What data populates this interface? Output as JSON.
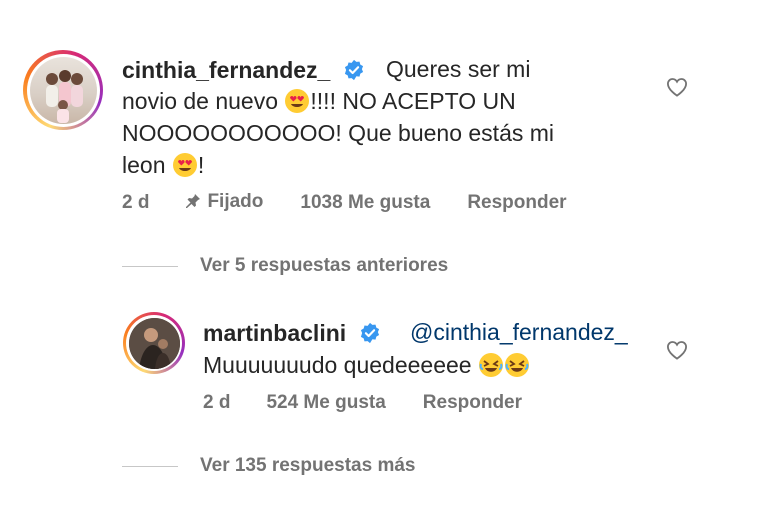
{
  "comments": [
    {
      "username": "cinthia_fernandez_",
      "verified": true,
      "text_line1": "Queres ser mi",
      "text_line2_a": "novio de nuevo",
      "text_line2_b": "!!!! NO ACEPTO UN",
      "text_line3": "NOOOOOOOOOOO! Que bueno estás mi",
      "text_line4": "leon",
      "text_line4_end": "!",
      "time": "2 d",
      "pinned_label": "Fijado",
      "likes": "1038 Me gusta",
      "reply_label": "Responder",
      "view_replies": "Ver 5 respuestas anteriores"
    },
    {
      "username": "martinbaclini",
      "verified": true,
      "mention": "@cinthia_fernandez_",
      "text": "Muuuuuuudo quedeeeeee",
      "time": "2 d",
      "likes": "524 Me gusta",
      "reply_label": "Responder",
      "view_replies": "Ver 135 respuestas más"
    }
  ],
  "icons": {
    "verified": "verified-badge-icon",
    "like": "heart-outline-icon",
    "pin": "pin-icon",
    "emoji_1": "heart-eyes-emoji",
    "emoji_2": "rolling-laughing-emoji"
  },
  "colors": {
    "verified_blue": "#3897f0",
    "meta_gray": "#737373",
    "mention_blue": "#00376b"
  }
}
